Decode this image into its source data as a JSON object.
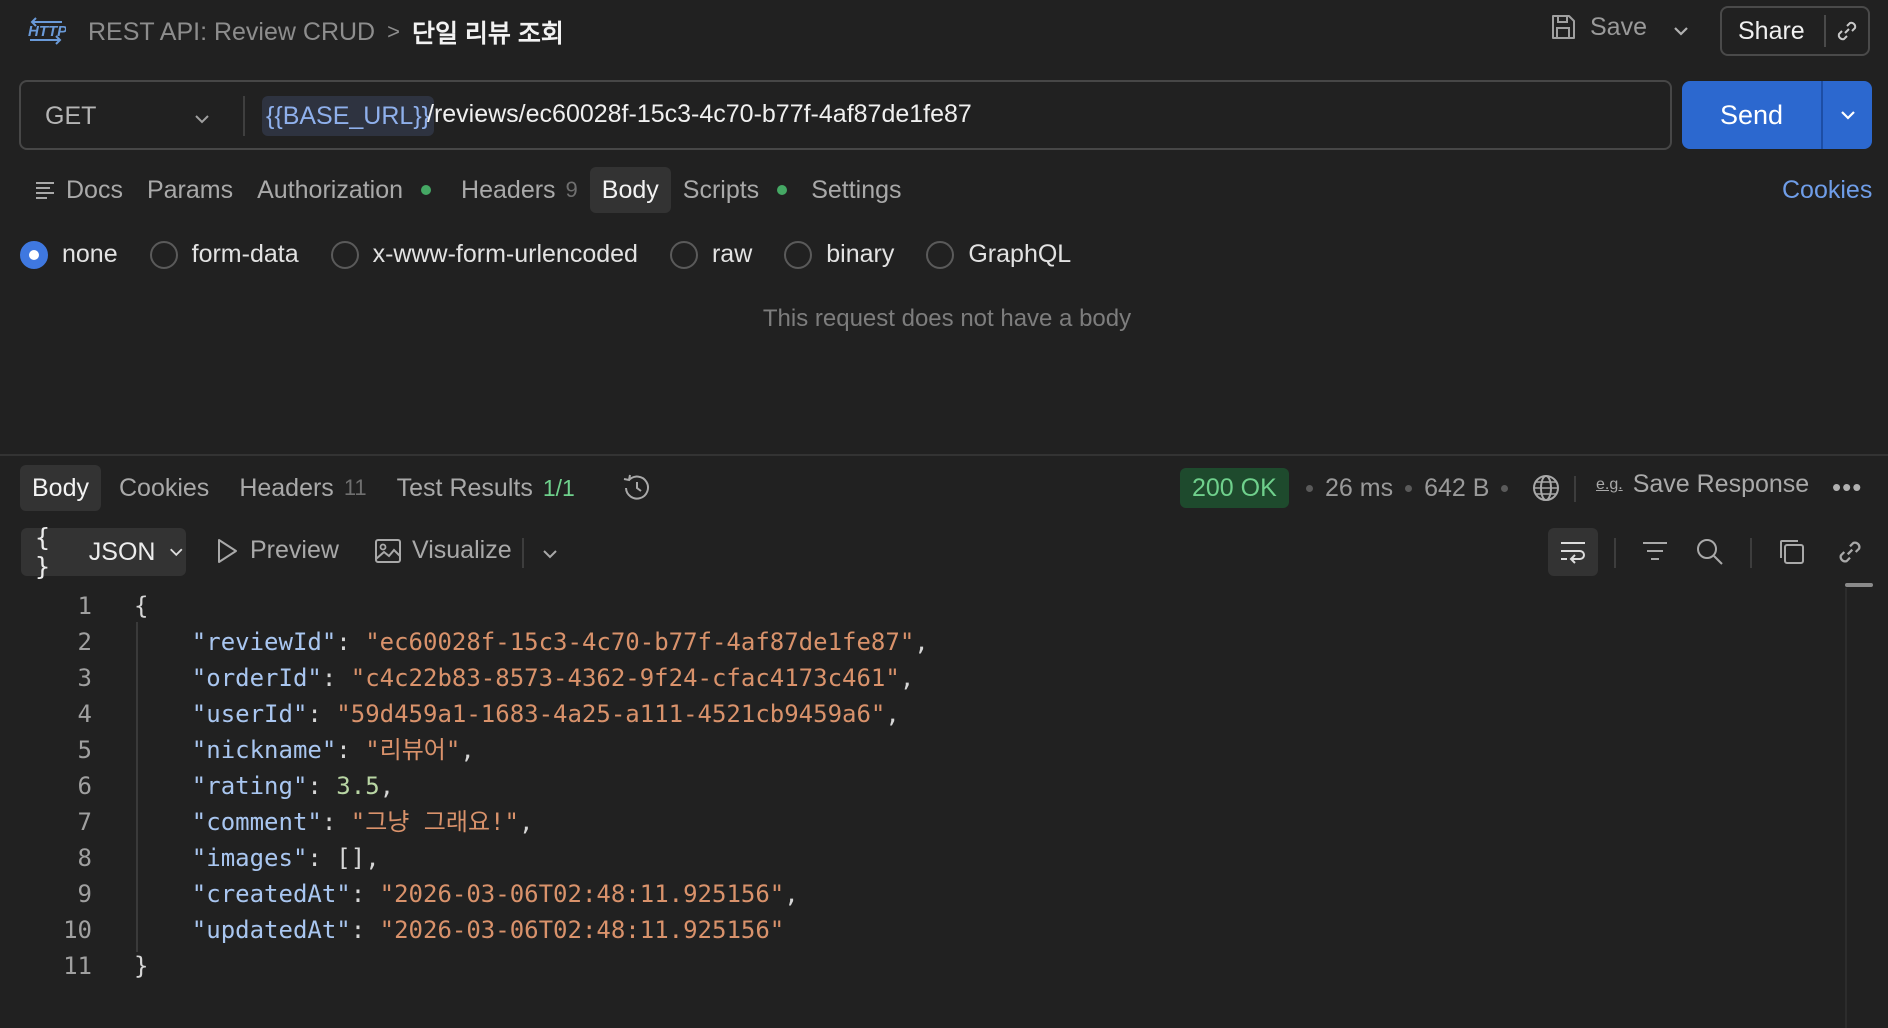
{
  "header": {
    "logo_icon": "http-icon",
    "breadcrumb_parent": "REST API: Review CRUD",
    "breadcrumb_separator": ">",
    "breadcrumb_current": "단일 리뷰 조회",
    "save_label": "Save",
    "share_label": "Share"
  },
  "request": {
    "method": "GET",
    "url_variable": "{{BASE_URL}}",
    "url_path": "/reviews/ec60028f-15c3-4c70-b77f-4af87de1fe87",
    "send_label": "Send"
  },
  "request_tabs": {
    "docs": "Docs",
    "params": "Params",
    "authorization": "Authorization",
    "headers": "Headers",
    "headers_count": "9",
    "body": "Body",
    "scripts": "Scripts",
    "settings": "Settings",
    "cookies": "Cookies",
    "active": "Body"
  },
  "body_types": {
    "none": "none",
    "form_data": "form-data",
    "urlencoded": "x-www-form-urlencoded",
    "raw": "raw",
    "binary": "binary",
    "graphql": "GraphQL",
    "selected": "none"
  },
  "body_empty_message": "This request does not have a body",
  "response": {
    "tabs": {
      "body": "Body",
      "cookies": "Cookies",
      "headers": "Headers",
      "headers_count": "11",
      "test_results": "Test Results",
      "test_results_count": "1/1",
      "active": "Body"
    },
    "status": "200 OK",
    "time": "26 ms",
    "size": "642 B",
    "save_response_prefix": "e.g.",
    "save_response_label": "Save Response",
    "more_label": "•••",
    "format": "JSON",
    "format_prefix": "{ }",
    "preview_label": "Preview",
    "visualize_label": "Visualize"
  },
  "colors": {
    "background": "#212121",
    "accent": "#2c68cf",
    "status_ok": "#6fd08c",
    "json_key": "#a9c6f0",
    "json_string": "#d9926b",
    "json_number": "#b9d6a4"
  },
  "code": {
    "line_numbers": [
      "1",
      "2",
      "3",
      "4",
      "5",
      "6",
      "7",
      "8",
      "9",
      "10",
      "11"
    ],
    "open_brace": "{",
    "close_brace": "}",
    "fields": [
      {
        "key": "\"reviewId\"",
        "value": "\"ec60028f-15c3-4c70-b77f-4af87de1fe87\"",
        "value_type": "string",
        "trail": ","
      },
      {
        "key": "\"orderId\"",
        "value": "\"c4c22b83-8573-4362-9f24-cfac4173c461\"",
        "value_type": "string",
        "trail": ","
      },
      {
        "key": "\"userId\"",
        "value": "\"59d459a1-1683-4a25-a111-4521cb9459a6\"",
        "value_type": "string",
        "trail": ","
      },
      {
        "key": "\"nickname\"",
        "value": "\"리뷰어\"",
        "value_type": "string",
        "trail": ","
      },
      {
        "key": "\"rating\"",
        "value": "3.5",
        "value_type": "number",
        "trail": ","
      },
      {
        "key": "\"comment\"",
        "value": "\"그냥 그래요!\"",
        "value_type": "string",
        "trail": ","
      },
      {
        "key": "\"images\"",
        "value": "[]",
        "value_type": "punct",
        "trail": ","
      },
      {
        "key": "\"createdAt\"",
        "value": "\"2026-03-06T02:48:11.925156\"",
        "value_type": "string",
        "trail": ","
      },
      {
        "key": "\"updatedAt\"",
        "value": "\"2026-03-06T02:48:11.925156\"",
        "value_type": "string",
        "trail": ""
      }
    ]
  }
}
